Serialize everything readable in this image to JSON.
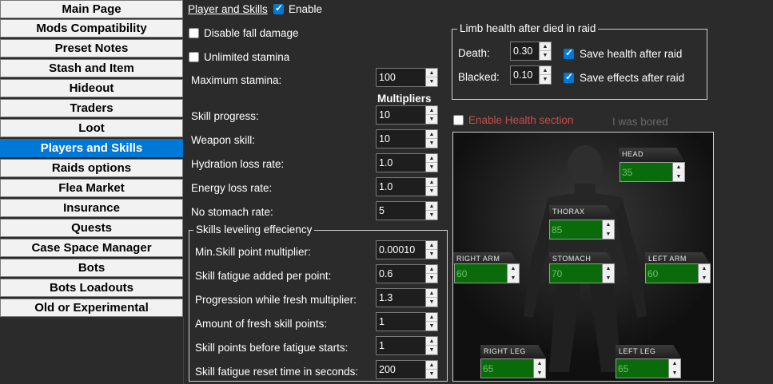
{
  "sidebar": {
    "items": [
      {
        "label": "Main Page"
      },
      {
        "label": "Mods Compatibility"
      },
      {
        "label": "Preset Notes"
      },
      {
        "label": "Stash and Item"
      },
      {
        "label": "Hideout"
      },
      {
        "label": "Traders"
      },
      {
        "label": "Loot"
      },
      {
        "label": "Players and Skills",
        "active": true
      },
      {
        "label": "Raids options"
      },
      {
        "label": "Flea Market"
      },
      {
        "label": "Insurance"
      },
      {
        "label": "Quests"
      },
      {
        "label": "Case Space Manager"
      },
      {
        "label": "Bots"
      },
      {
        "label": "Bots Loadouts"
      },
      {
        "label": "Old or Experimental"
      }
    ]
  },
  "header": {
    "title": "Player and Skills",
    "enable_label": "Enable",
    "enable_checked": true
  },
  "options": {
    "disable_fall_damage": {
      "label": "Disable fall damage",
      "checked": false
    },
    "unlimited_stamina": {
      "label": "Unlimited stamina",
      "checked": false
    },
    "max_stamina": {
      "label": "Maximum stamina:",
      "value": "100"
    }
  },
  "multipliers": {
    "heading": "Multipliers",
    "rows": [
      {
        "label": "Skill progress:",
        "value": "10"
      },
      {
        "label": "Weapon skill:",
        "value": "10"
      },
      {
        "label": "Hydration loss rate:",
        "value": "1.0"
      },
      {
        "label": "Energy loss rate:",
        "value": "1.0"
      },
      {
        "label": "No stomach rate:",
        "value": "5"
      }
    ]
  },
  "skills_leveling": {
    "title": "Skills leveling effeciency",
    "rows": [
      {
        "label": "Min.Skill point multiplier:",
        "value": "0.00010"
      },
      {
        "label": "Skill fatigue added per point:",
        "value": "0.6"
      },
      {
        "label": "Progression while fresh multiplier:",
        "value": "1.3"
      },
      {
        "label": "Amount of fresh skill points:",
        "value": "1"
      },
      {
        "label": "Skill points before fatigue starts:",
        "value": "1"
      },
      {
        "label": "Skill fatigue reset time in seconds:",
        "value": "200"
      }
    ]
  },
  "limb_health": {
    "title": "Limb health after died in raid",
    "death_label": "Death:",
    "death_value": "0.30",
    "blacked_label": "Blacked:",
    "blacked_value": "0.10",
    "save_health": {
      "label": "Save health after raid",
      "checked": true
    },
    "save_effects": {
      "label": "Save effects after raid",
      "checked": true
    }
  },
  "health_section": {
    "enable_label": "Enable Health section",
    "enable_checked": false,
    "note": "I was bored",
    "parts": {
      "head": {
        "label": "HEAD",
        "value": "35"
      },
      "thorax": {
        "label": "THORAX",
        "value": "85"
      },
      "right_arm": {
        "label": "RIGHT ARM",
        "value": "60"
      },
      "stomach": {
        "label": "STOMACH",
        "value": "70"
      },
      "left_arm": {
        "label": "LEFT ARM",
        "value": "60"
      },
      "right_leg": {
        "label": "RIGHT LEG",
        "value": "65"
      },
      "left_leg": {
        "label": "LEFT LEG",
        "value": "65"
      }
    }
  },
  "colors": {
    "accent": "#0078d7",
    "health_red": "#c94c4c",
    "part_green": "#0a6b0a"
  }
}
